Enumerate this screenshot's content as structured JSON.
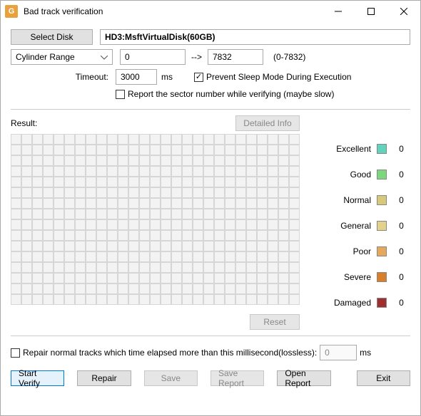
{
  "window": {
    "title": "Bad track verification"
  },
  "selectDiskLabel": "Select Disk",
  "diskValue": "HD3:MsftVirtualDisk(60GB)",
  "cylinderRangeLabel": "Cylinder Range",
  "cylFrom": "0",
  "cylArrow": "-->",
  "cylTo": "7832",
  "cylRangeHint": "(0-7832)",
  "timeoutLabel": "Timeout:",
  "timeoutValue": "3000",
  "timeoutUnit": "ms",
  "preventSleepLabel": "Prevent Sleep Mode During Execution",
  "preventSleepChecked": true,
  "reportSectorLabel": "Report the sector number while verifying (maybe slow)",
  "reportSectorChecked": false,
  "resultLabel": "Result:",
  "detailedInfoLabel": "Detailed Info",
  "legend": [
    {
      "label": "Excellent",
      "color": "#5fd3bc",
      "count": "0"
    },
    {
      "label": "Good",
      "color": "#7cd87c",
      "count": "0"
    },
    {
      "label": "Normal",
      "color": "#d8c97a",
      "count": "0"
    },
    {
      "label": "General",
      "color": "#e5d28a",
      "count": "0"
    },
    {
      "label": "Poor",
      "color": "#e6a85a",
      "count": "0"
    },
    {
      "label": "Severe",
      "color": "#d97f2a",
      "count": "0"
    },
    {
      "label": "Damaged",
      "color": "#a03030",
      "count": "0"
    }
  ],
  "resetLabel": "Reset",
  "repairRowLabel": "Repair normal tracks which time elapsed more than this millisecond(lossless):",
  "repairMsValue": "0",
  "repairMsUnit": "ms",
  "buttons": {
    "startVerify": "Start Verify",
    "repair": "Repair",
    "save": "Save",
    "saveReport": "Save Report",
    "openReport": "Open Report",
    "exit": "Exit"
  }
}
